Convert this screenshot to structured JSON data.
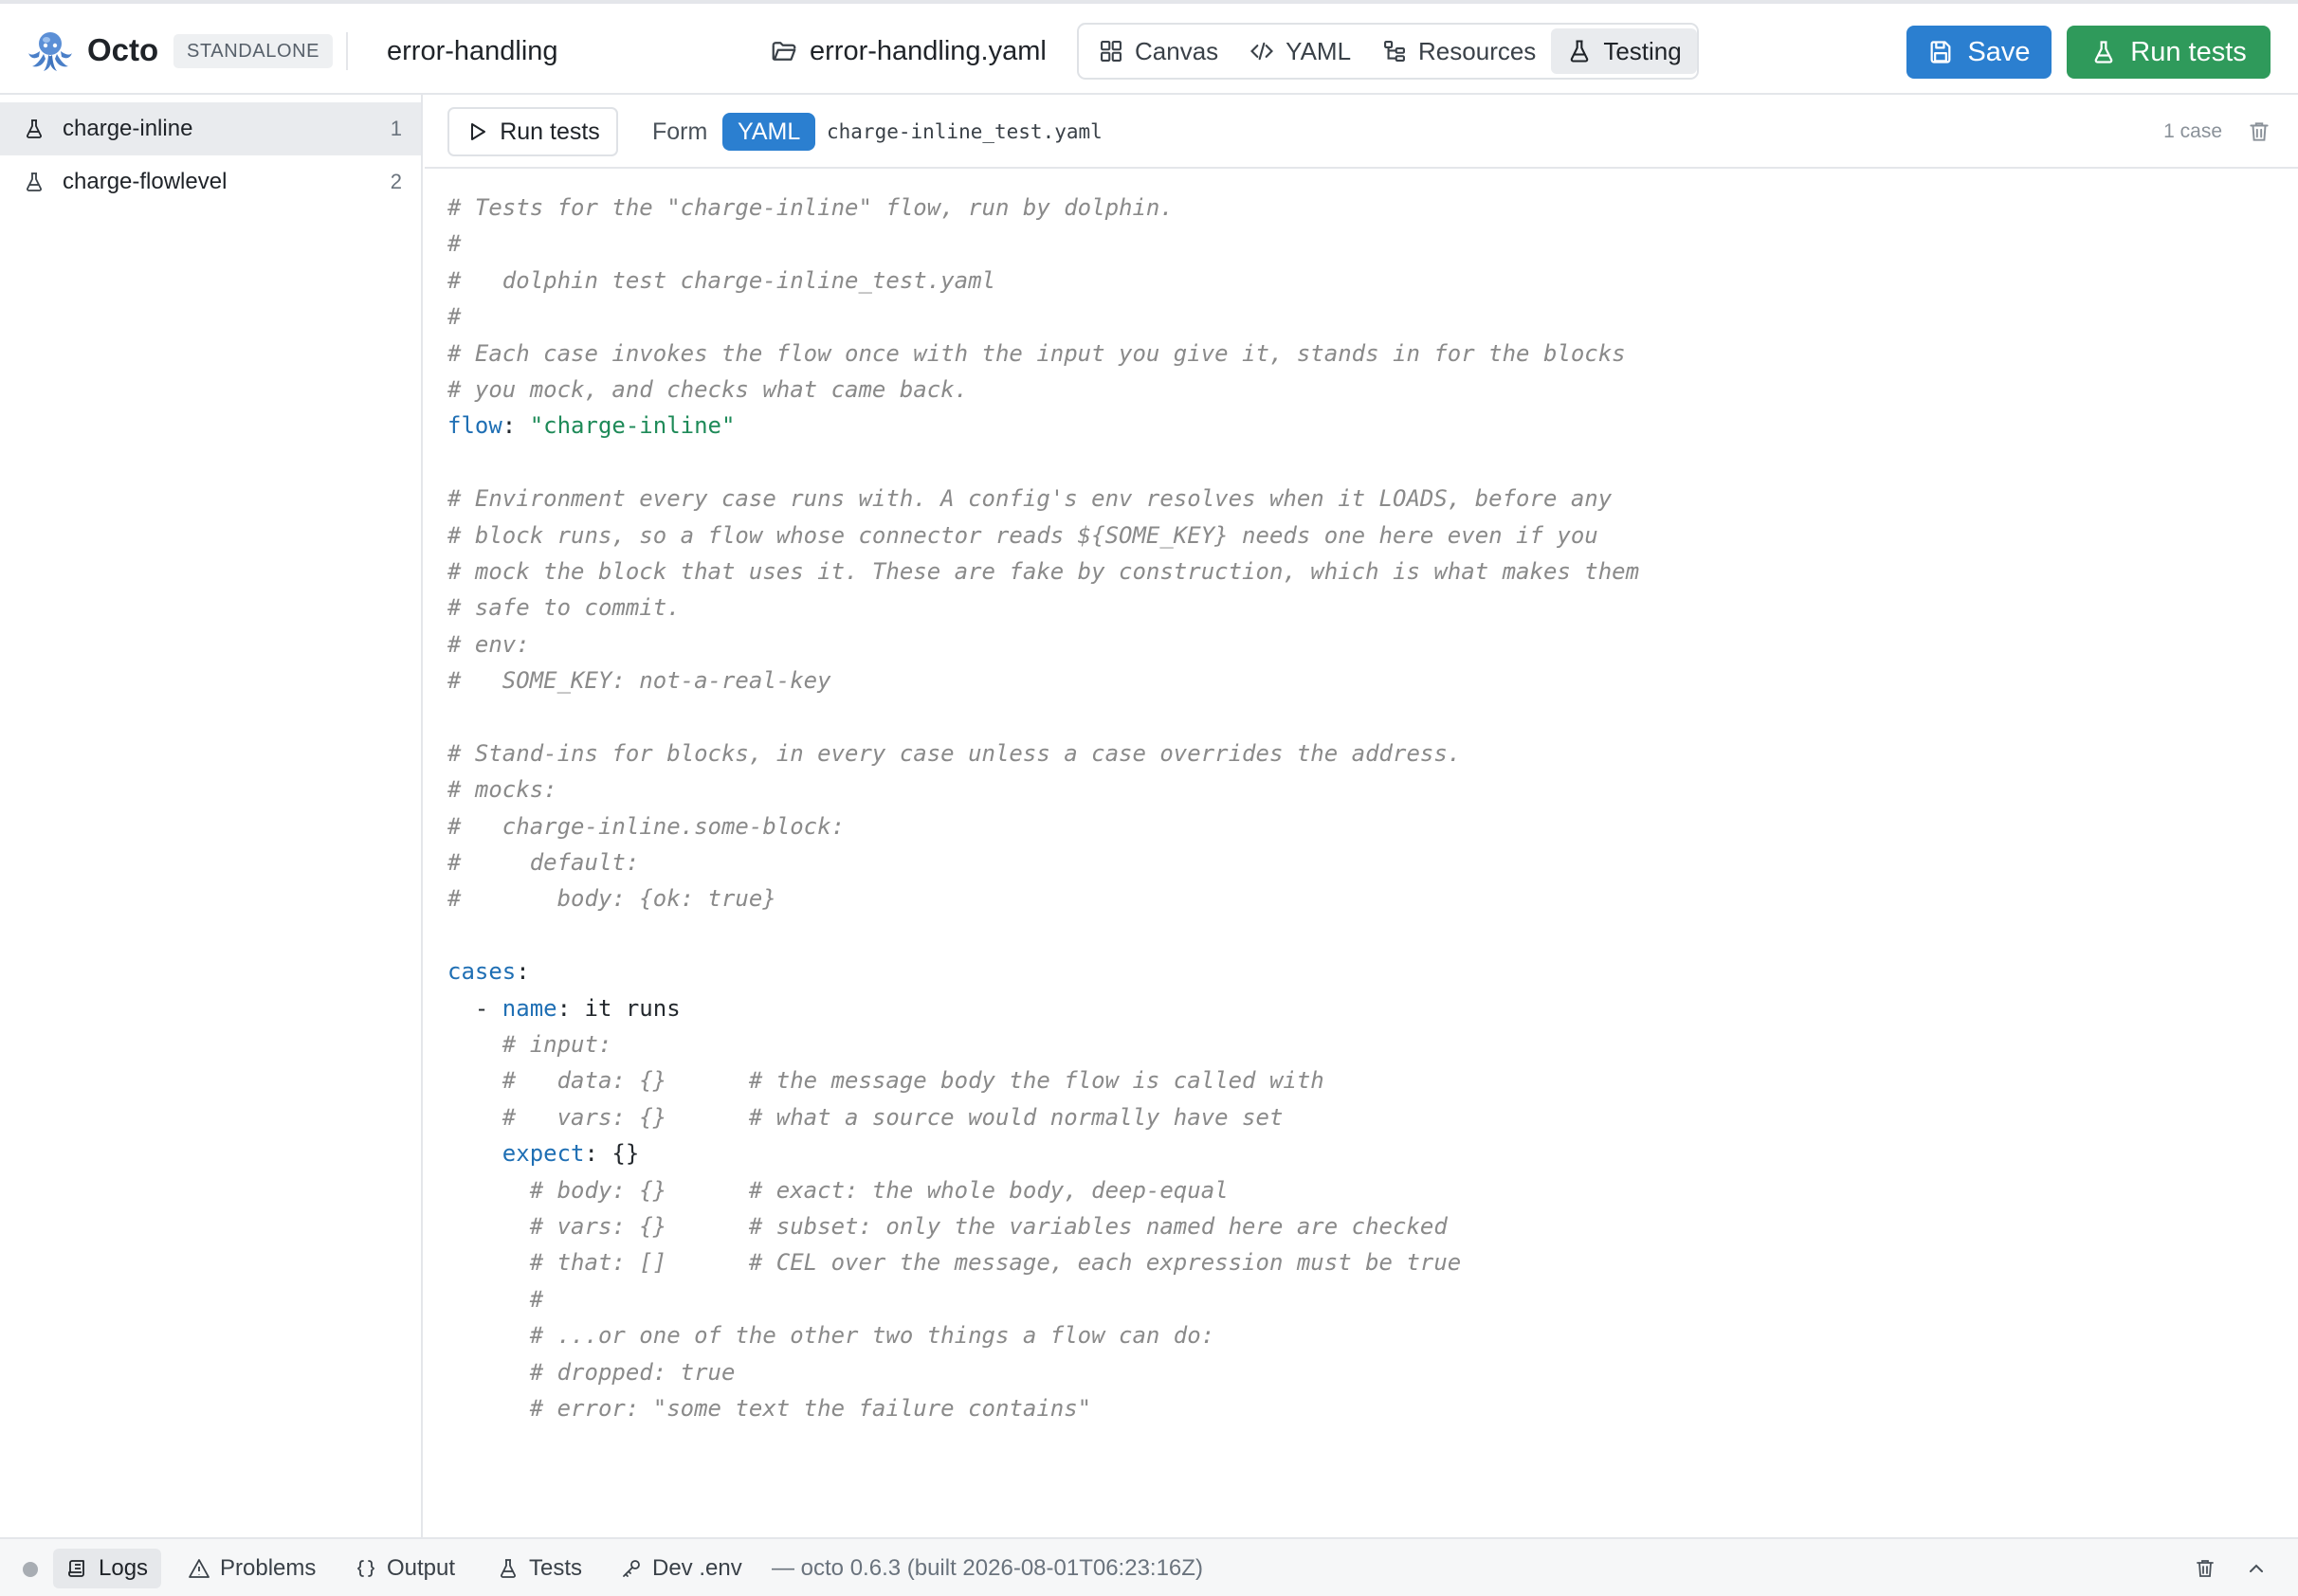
{
  "app": {
    "name": "Octo",
    "mode_badge": "STANDALONE",
    "project": "error-handling",
    "file": "error-handling.yaml"
  },
  "view_tabs": [
    {
      "label": "Canvas",
      "icon": "grid-icon",
      "active": false
    },
    {
      "label": "YAML",
      "icon": "code-icon",
      "active": false
    },
    {
      "label": "Resources",
      "icon": "tree-icon",
      "active": false
    },
    {
      "label": "Testing",
      "icon": "flask-icon",
      "active": true
    }
  ],
  "actions": {
    "save": "Save",
    "run_tests": "Run tests"
  },
  "sidebar": {
    "items": [
      {
        "label": "charge-inline",
        "count": "1",
        "active": true,
        "icon": "flask-icon"
      },
      {
        "label": "charge-flowlevel",
        "count": "2",
        "active": false,
        "icon": "flask-icon"
      }
    ]
  },
  "editor": {
    "run_label": "Run tests",
    "form_label": "Form",
    "yaml_label": "YAML",
    "file": "charge-inline_test.yaml",
    "case_count": "1 case",
    "lines": [
      [
        {
          "t": "# Tests for the \"charge-inline\" flow, run by dolphin.",
          "c": "cm"
        }
      ],
      [
        {
          "t": "#",
          "c": "cm"
        }
      ],
      [
        {
          "t": "#   dolphin test charge-inline_test.yaml",
          "c": "cm"
        }
      ],
      [
        {
          "t": "#",
          "c": "cm"
        }
      ],
      [
        {
          "t": "# Each case invokes the flow once with the input you give it, stands in for the blocks",
          "c": "cm"
        }
      ],
      [
        {
          "t": "# you mock, and checks what came back.",
          "c": "cm"
        }
      ],
      [
        {
          "t": "flow",
          "c": "key"
        },
        {
          "t": ": ",
          "c": "plain"
        },
        {
          "t": "\"charge-inline\"",
          "c": "str"
        }
      ],
      [],
      [
        {
          "t": "# Environment every case runs with. A config's env resolves when it LOADS, before any",
          "c": "cm"
        }
      ],
      [
        {
          "t": "# block runs, so a flow whose connector reads ${SOME_KEY} needs one here even if you",
          "c": "cm"
        }
      ],
      [
        {
          "t": "# mock the block that uses it. These are fake by construction, which is what makes them",
          "c": "cm"
        }
      ],
      [
        {
          "t": "# safe to commit.",
          "c": "cm"
        }
      ],
      [
        {
          "t": "# env:",
          "c": "cm"
        }
      ],
      [
        {
          "t": "#   SOME_KEY: not-a-real-key",
          "c": "cm"
        }
      ],
      [],
      [
        {
          "t": "# Stand-ins for blocks, in every case unless a case overrides the address.",
          "c": "cm"
        }
      ],
      [
        {
          "t": "# mocks:",
          "c": "cm"
        }
      ],
      [
        {
          "t": "#   charge-inline.some-block:",
          "c": "cm"
        }
      ],
      [
        {
          "t": "#     default:",
          "c": "cm"
        }
      ],
      [
        {
          "t": "#       body: {ok: true}",
          "c": "cm"
        }
      ],
      [],
      [
        {
          "t": "cases",
          "c": "key"
        },
        {
          "t": ":",
          "c": "plain"
        }
      ],
      [
        {
          "t": "  - ",
          "c": "plain"
        },
        {
          "t": "name",
          "c": "key"
        },
        {
          "t": ": it runs",
          "c": "plain"
        }
      ],
      [
        {
          "t": "    # input:",
          "c": "cm"
        }
      ],
      [
        {
          "t": "    #   data: {}      # the message body the flow is called with",
          "c": "cm"
        }
      ],
      [
        {
          "t": "    #   vars: {}      # what a source would normally have set",
          "c": "cm"
        }
      ],
      [
        {
          "t": "    ",
          "c": "plain"
        },
        {
          "t": "expect",
          "c": "key"
        },
        {
          "t": ": {}",
          "c": "plain"
        }
      ],
      [
        {
          "t": "      # body: {}      # exact: the whole body, deep-equal",
          "c": "cm"
        }
      ],
      [
        {
          "t": "      # vars: {}      # subset: only the variables named here are checked",
          "c": "cm"
        }
      ],
      [
        {
          "t": "      # that: []      # CEL over the message, each expression must be true",
          "c": "cm"
        }
      ],
      [
        {
          "t": "      #",
          "c": "cm"
        }
      ],
      [
        {
          "t": "      # ...or one of the other two things a flow can do:",
          "c": "cm"
        }
      ],
      [
        {
          "t": "      # dropped: true",
          "c": "cm"
        }
      ],
      [
        {
          "t": "      # error: \"some text the failure contains\"",
          "c": "cm"
        }
      ]
    ]
  },
  "statusbar": {
    "items": [
      {
        "label": "Logs",
        "icon": "scroll-icon",
        "active": true
      },
      {
        "label": "Problems",
        "icon": "warning-icon",
        "active": false
      },
      {
        "label": "Output",
        "icon": "braces-icon",
        "active": false
      },
      {
        "label": "Tests",
        "icon": "flask-icon",
        "active": false
      },
      {
        "label": "Dev .env",
        "icon": "key-icon",
        "active": false
      }
    ],
    "version": "— octo 0.6.3 (built 2026-08-01T06:23:16Z)"
  },
  "colors": {
    "primary": "#2b7fd0",
    "success": "#2f9a5b",
    "comment": "#8a8a8a",
    "yaml_key": "#1f6fb4",
    "yaml_string": "#1e8a58"
  }
}
